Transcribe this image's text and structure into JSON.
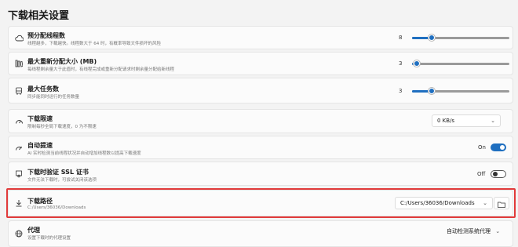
{
  "section": {
    "title": "下载相关设置"
  },
  "rows": {
    "prealloc": {
      "title": "预分配线程数",
      "desc": "线程越多，下载越快。线程数大于 64 时，有概率导致文件损坏的风险",
      "value": "8",
      "level": 0.2
    },
    "maxsplit": {
      "title": "最大重新分配大小 (MB)",
      "desc": "每线程剩余量大于此值时，有线程完成或重新分配请求时剩余量分配给新线程",
      "value": "3",
      "level": 0.05
    },
    "maxtasks": {
      "title": "最大任务数",
      "desc": "同步能同时运行的任务数量",
      "value": "3",
      "level": 0.2
    },
    "speedlimit": {
      "title": "下载限速",
      "desc": "限制每秒全局下载速度，0 为不限速",
      "value": "0 KB/s"
    },
    "autospeed": {
      "title": "自动提速",
      "desc": "AI 实时检测当前线程状况并自动增加线程数以提高下载速度",
      "state": "On"
    },
    "ssl": {
      "title": "下载时验证 SSL 证书",
      "desc": "文件无法下载时，可尝试关闭该选项",
      "state": "Off"
    },
    "path": {
      "title": "下载路径",
      "desc": "C:/Users/36036/Downloads",
      "value": "C:/Users/36036/Downloads"
    },
    "proxy": {
      "title": "代理",
      "desc": "设置下载时的代理设置",
      "value": "自动检测系统代理"
    }
  },
  "colors": {
    "accent": "#1f6fc0",
    "highlight": "#e13a3a"
  }
}
